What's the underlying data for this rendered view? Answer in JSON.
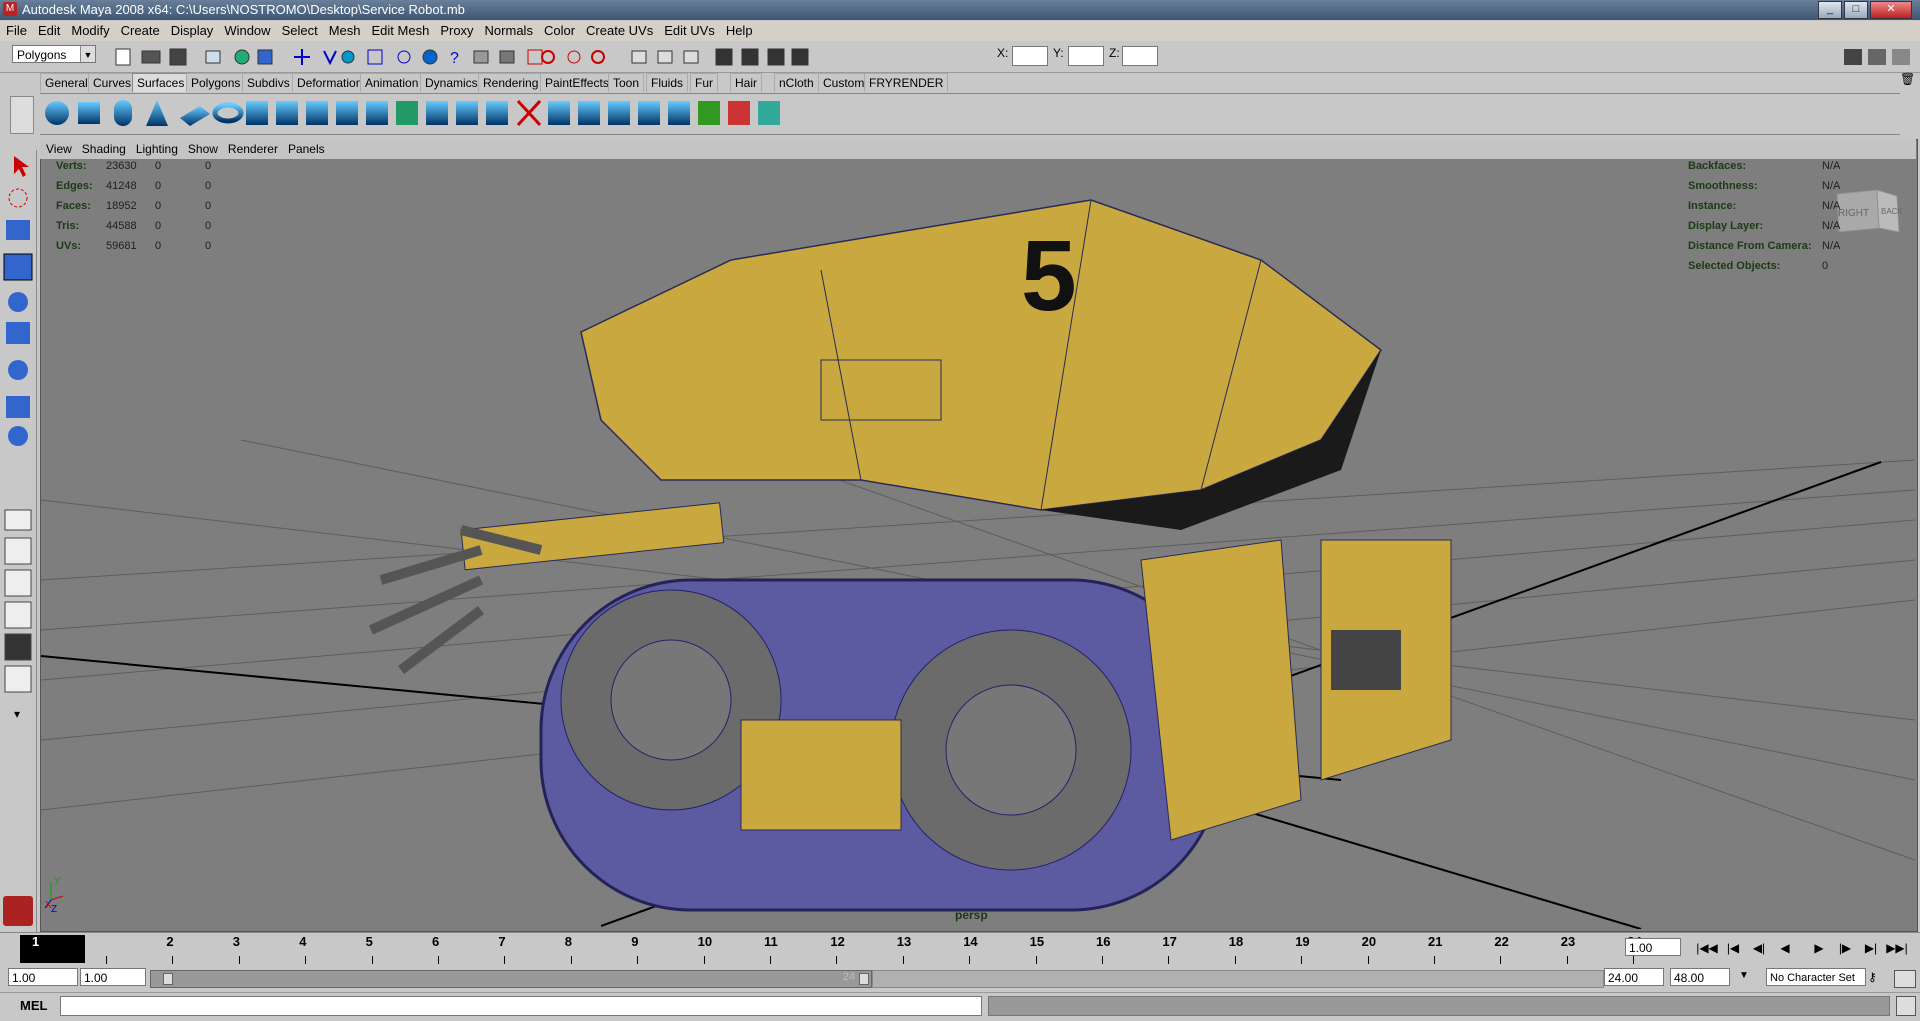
{
  "window": {
    "title": "Autodesk Maya 2008 x64: C:\\Users\\NOSTROMO\\Desktop\\Service Robot.mb",
    "logo": "maya-logo"
  },
  "menubar": {
    "items": [
      "File",
      "Edit",
      "Modify",
      "Create",
      "Display",
      "Window",
      "Select",
      "Mesh",
      "Edit Mesh",
      "Proxy",
      "Normals",
      "Color",
      "Create UVs",
      "Edit UVs",
      "Help"
    ]
  },
  "statusline": {
    "menuset": "Polygons",
    "x_label": "X:",
    "y_label": "Y:",
    "z_label": "Z:"
  },
  "shelf": {
    "tabs": [
      "General",
      "Curves",
      "Surfaces",
      "Polygons",
      "Subdivs",
      "Deformation",
      "Animation",
      "Dynamics",
      "Rendering",
      "PaintEffects",
      "Toon",
      "Fluids",
      "Fur",
      "Hair",
      "nCloth",
      "Custom",
      "FRYRENDER"
    ],
    "active_tab": "Surfaces"
  },
  "viewport": {
    "menu": [
      "View",
      "Shading",
      "Lighting",
      "Show",
      "Renderer",
      "Panels"
    ],
    "camera_label": "persp",
    "hud_left": [
      {
        "label": "Verts:",
        "v1": "23630",
        "v2": "0",
        "v3": "0"
      },
      {
        "label": "Edges:",
        "v1": "41248",
        "v2": "0",
        "v3": "0"
      },
      {
        "label": "Faces:",
        "v1": "18952",
        "v2": "0",
        "v3": "0"
      },
      {
        "label": "Tris:",
        "v1": "44588",
        "v2": "0",
        "v3": "0"
      },
      {
        "label": "UVs:",
        "v1": "59681",
        "v2": "0",
        "v3": "0"
      }
    ],
    "hud_right": [
      {
        "label": "Backfaces:",
        "value": "N/A"
      },
      {
        "label": "Smoothness:",
        "value": "N/A"
      },
      {
        "label": "Instance:",
        "value": "N/A"
      },
      {
        "label": "Display Layer:",
        "value": "N/A"
      },
      {
        "label": "Distance From Camera:",
        "value": "N/A"
      },
      {
        "label": "Selected Objects:",
        "value": "0"
      }
    ],
    "viewcube": {
      "right": "RIGHT",
      "back": "BACK"
    },
    "axis": {
      "y": "Y",
      "x": "X",
      "z": "Z"
    },
    "robot_number": "5"
  },
  "timeline": {
    "frames": [
      "1",
      "2",
      "3",
      "4",
      "5",
      "6",
      "7",
      "8",
      "9",
      "10",
      "11",
      "12",
      "13",
      "14",
      "15",
      "16",
      "17",
      "18",
      "19",
      "20",
      "21",
      "22",
      "23",
      "24"
    ],
    "current_frame": "1",
    "current_field": "1.00"
  },
  "range": {
    "start": "1.00",
    "play_start": "1.00",
    "play_end": "24.00",
    "end": "48.00",
    "char_set": "No Character Set",
    "slider_end": "24"
  },
  "cmd": {
    "label": "MEL"
  }
}
